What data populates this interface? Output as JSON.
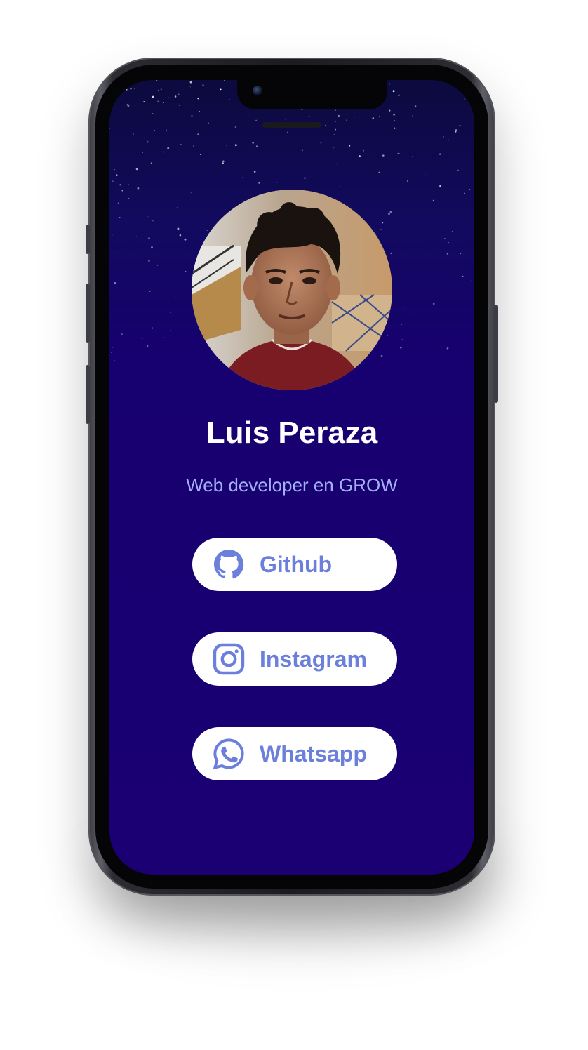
{
  "profile": {
    "name": "Luis Peraza",
    "subtitle": "Web developer en GROW",
    "avatar_alt": "profile photo"
  },
  "links": [
    {
      "label": "Github",
      "icon": "github-icon"
    },
    {
      "label": "Instagram",
      "icon": "instagram-icon"
    },
    {
      "label": "Whatsapp",
      "icon": "whatsapp-icon"
    }
  ],
  "colors": {
    "background": "#1a0073",
    "accent": "#6b7fdb",
    "subtitle": "#a3b0f5",
    "button_bg": "#ffffff",
    "name": "#ffffff"
  }
}
